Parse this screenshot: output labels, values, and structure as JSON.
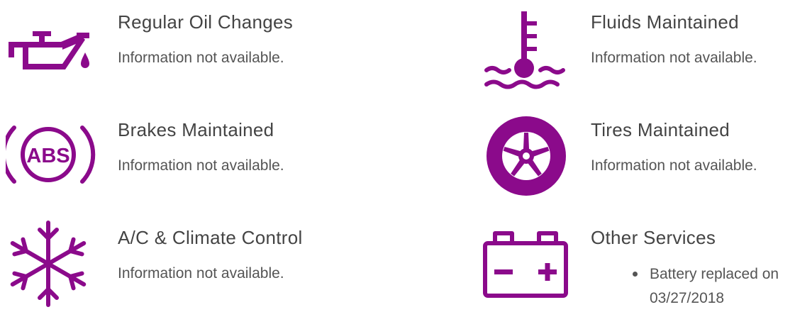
{
  "accent_color": "#8b0a8b",
  "services": [
    {
      "icon": "oil-can-icon",
      "title": "Regular Oil Changes",
      "description": "Information not available."
    },
    {
      "icon": "coolant-temperature-icon",
      "title": "Fluids Maintained",
      "description": "Information not available."
    },
    {
      "icon": "abs-brake-icon",
      "title": "Brakes Maintained",
      "description": "Information not available."
    },
    {
      "icon": "tire-icon",
      "title": "Tires Maintained",
      "description": "Information not available."
    },
    {
      "icon": "snowflake-icon",
      "title": "A/C & Climate Control",
      "description": "Information not available."
    },
    {
      "icon": "battery-icon",
      "title": "Other Services",
      "bullets": [
        "Battery replaced on 03/27/2018"
      ]
    }
  ]
}
